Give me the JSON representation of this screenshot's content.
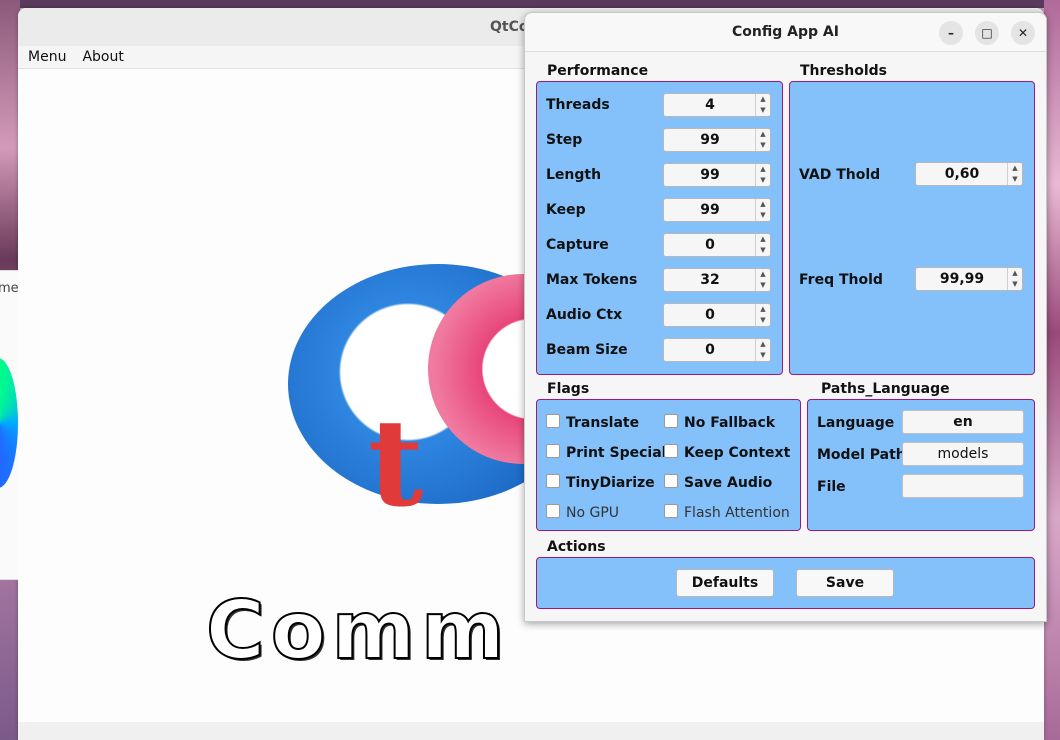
{
  "background_app": {
    "title_partial": "QtCo",
    "menu": [
      "Menu",
      "About"
    ],
    "logo_word_partial": "Comm",
    "left_panel_text_partial": "me"
  },
  "dialog": {
    "title": "Config App AI",
    "controls": {
      "minimize": "–",
      "maximize": "□",
      "close": "✕"
    },
    "performance": {
      "label": "Performance",
      "rows": [
        {
          "label": "Threads",
          "value": "4"
        },
        {
          "label": "Step",
          "value": "99"
        },
        {
          "label": "Length",
          "value": "99"
        },
        {
          "label": "Keep",
          "value": "99"
        },
        {
          "label": "Capture",
          "value": "0"
        },
        {
          "label": "Max Tokens",
          "value": "32"
        },
        {
          "label": "Audio Ctx",
          "value": "0"
        },
        {
          "label": "Beam Size",
          "value": "0"
        }
      ]
    },
    "thresholds": {
      "label": "Thresholds",
      "rows": [
        {
          "label": "VAD Thold",
          "value": "0,60"
        },
        {
          "label": "Freq Thold",
          "value": "99,99"
        }
      ]
    },
    "flags": {
      "label": "Flags",
      "items": [
        {
          "label": "Translate",
          "checked": false,
          "enabled": true
        },
        {
          "label": "No Fallback",
          "checked": false,
          "enabled": true
        },
        {
          "label": "Print Special",
          "checked": false,
          "enabled": true
        },
        {
          "label": "Keep Context",
          "checked": false,
          "enabled": true
        },
        {
          "label": "TinyDiarize",
          "checked": false,
          "enabled": true
        },
        {
          "label": "Save Audio",
          "checked": false,
          "enabled": true
        },
        {
          "label": "No GPU",
          "checked": false,
          "enabled": false
        },
        {
          "label": "Flash Attention",
          "checked": false,
          "enabled": false
        }
      ]
    },
    "paths_language": {
      "label": "Paths_Language",
      "rows": [
        {
          "label": "Language",
          "value": "en"
        },
        {
          "label": "Model Path",
          "value": "models"
        },
        {
          "label": "File",
          "value": ""
        }
      ]
    },
    "actions": {
      "label": "Actions",
      "defaults": "Defaults",
      "save": "Save"
    }
  },
  "colors": {
    "group_bg": "#84c1fb",
    "group_border": "#9c1a7a"
  }
}
